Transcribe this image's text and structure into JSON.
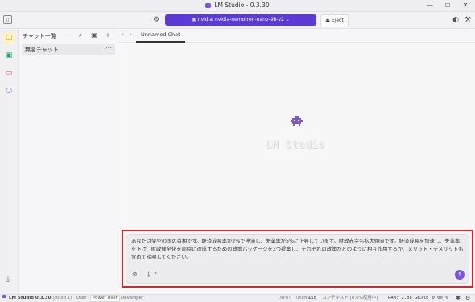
{
  "window": {
    "title": "LM Studio - 0.3.30",
    "minimize": "—",
    "maximize": "☐",
    "close": "✕"
  },
  "toolbar": {
    "model_name": "nvidia_nvidia-nemotron-nano-9b-v2",
    "eject_label": "Eject"
  },
  "sidebar": {
    "header": "チャット一覧",
    "chats": [
      {
        "label": "無名チャット"
      }
    ]
  },
  "tabs": [
    {
      "label": "Unnamed Chat"
    }
  ],
  "main": {
    "brand": "LM Studio"
  },
  "input": {
    "text": "あなたは架空の国の首相です。経済成長率が2%で停滞し、失業率が5%に上昇しています。財政赤字も拡大傾向です。経済成長を加速し、失業率を下げ、財政健全化を同時に達成するための政策パッケージを3つ提案し、それぞれの政策がどのように相互作用するか、メリット・デメリットも含めて説明してください。"
  },
  "status": {
    "app": "LM Studio 0.3.30",
    "build": "(Build 1)",
    "modes": [
      "User",
      "Power User",
      "Developer"
    ],
    "input_tokens_label": "INPUT TOKENS:",
    "input_tokens": "118",
    "context": "コンテキスト:[0.6%使用中]",
    "ram": "RAM: 2.88 GB",
    "cpu": "CPU: 0.00 %"
  },
  "colors": {
    "accent": "#5b3ad6",
    "highlight": "#d8262d"
  }
}
